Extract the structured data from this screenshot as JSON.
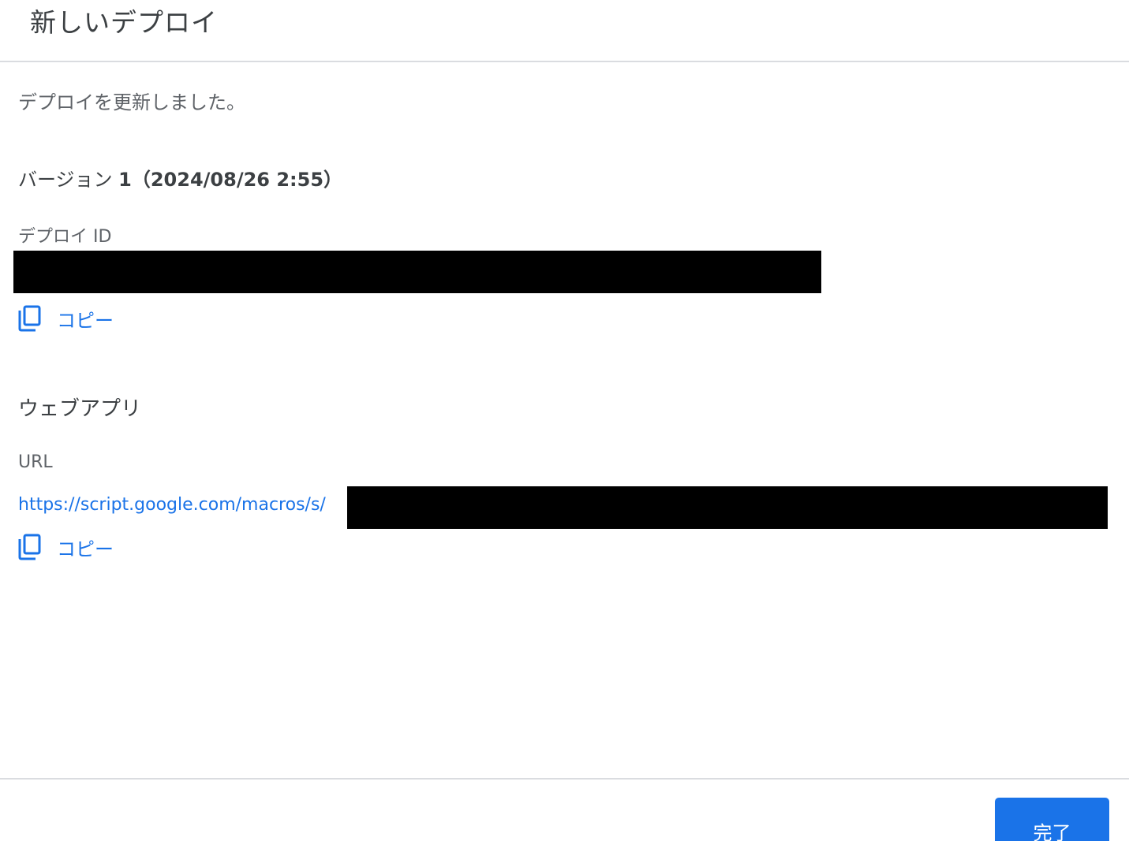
{
  "dialog": {
    "title": "新しいデプロイ",
    "message": "デプロイを更新しました。",
    "version": {
      "prefix": "バージョン ",
      "number": "1",
      "date": "（2024/08/26 2:55）"
    },
    "deploy_id": {
      "label": "デプロイ ID",
      "copy_label": "コピー"
    },
    "web_app": {
      "section_title": "ウェブアプリ",
      "url_label": "URL",
      "url_prefix": "https://script.google.com/macros/s/",
      "copy_label": "コピー"
    },
    "done_label": "完了"
  },
  "colors": {
    "accent": "#1a73e8",
    "text_primary": "#3c4043",
    "text_secondary": "#5f6368",
    "divider": "#dadce0",
    "redaction": "#000000"
  },
  "icons": {
    "copy": "copy-icon"
  }
}
